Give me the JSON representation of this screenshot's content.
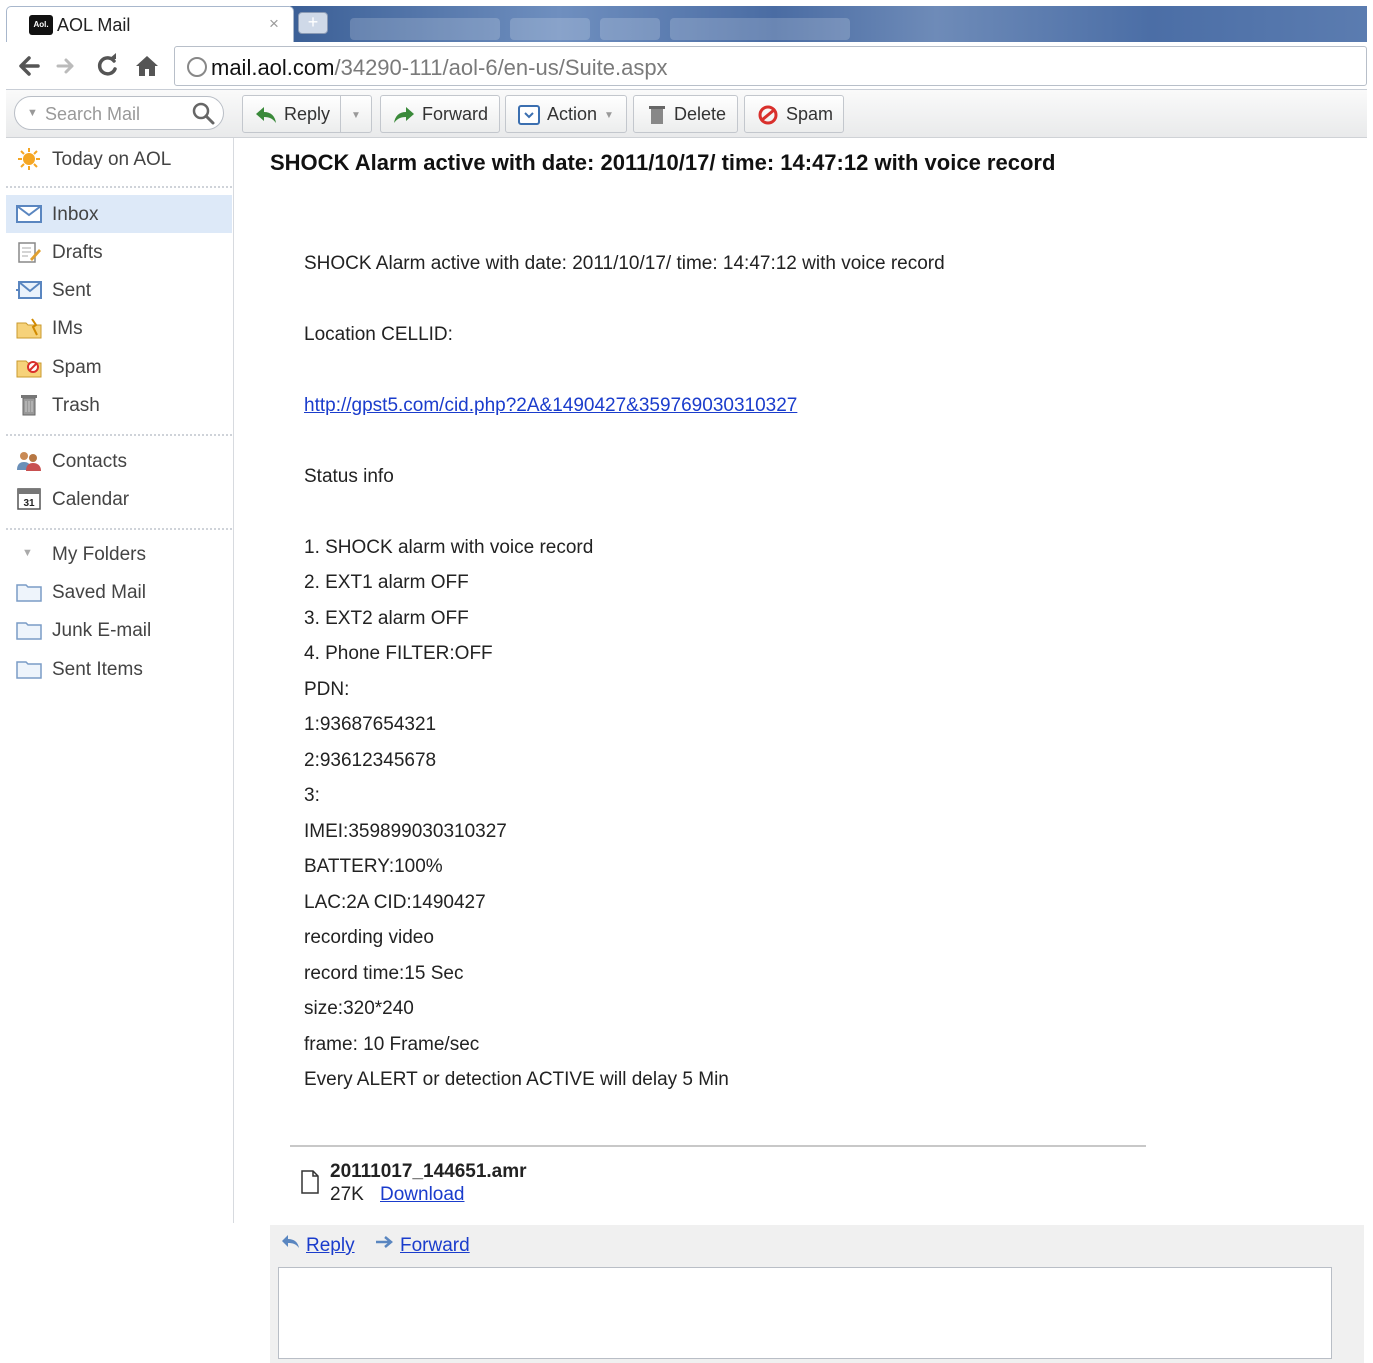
{
  "browser": {
    "tab_title": "AOL Mail",
    "tab_logo_text": "Aol.",
    "tab_close": "×",
    "new_tab": "+",
    "url_host": "mail.aol.com",
    "url_path": "/34290-111/aol-6/en-us/Suite.aspx"
  },
  "toolbar": {
    "search_placeholder": "Search Mail",
    "reply": "Reply",
    "forward": "Forward",
    "action": "Action",
    "delete": "Delete",
    "spam": "Spam"
  },
  "sidebar": {
    "today": "Today on AOL",
    "folders": [
      {
        "label": "Inbox",
        "icon": "inbox-icon"
      },
      {
        "label": "Drafts",
        "icon": "drafts-icon"
      },
      {
        "label": "Sent",
        "icon": "sent-icon"
      },
      {
        "label": "IMs",
        "icon": "ims-icon"
      },
      {
        "label": "Spam",
        "icon": "spam-folder-icon"
      },
      {
        "label": "Trash",
        "icon": "trash-icon"
      }
    ],
    "contacts": "Contacts",
    "calendar": "Calendar",
    "calendar_day": "31",
    "my_folders": "My Folders",
    "custom_folders": [
      "Saved Mail",
      "Junk E-mail",
      "Sent Items"
    ]
  },
  "message": {
    "subject": "SHOCK Alarm active with date: 2011/10/17/ time: 14:47:12 with voice record",
    "line_intro": "SHOCK Alarm active with date: 2011/10/17/ time: 14:47:12  with voice record",
    "line_location": "Location CELLID:",
    "link": "http://gpst5.com/cid.php?2A&1490427&359769030310327",
    "line_status": "Status info",
    "status_lines": [
      "1. SHOCK alarm  with voice record",
      "2. EXT1 alarm OFF",
      "3. EXT2 alarm OFF",
      "4. Phone FILTER:OFF",
      "PDN:",
      "1:93687654321",
      "2:93612345678",
      "3:",
      "IMEI:359899030310327",
      "BATTERY:100%",
      "LAC:2A CID:1490427",
      "recording video",
      "record time:15 Sec",
      "size:320*240",
      "frame: 10 Frame/sec",
      "Every ALERT or detection ACTIVE will delay  5 Min"
    ],
    "attachment": {
      "name": "20111017_144651.amr",
      "size": "27K",
      "download": "Download"
    }
  },
  "quick_reply": {
    "reply": "Reply",
    "forward": "Forward",
    "placeholder": ""
  },
  "colors": {
    "link": "#1a3ccc",
    "selected_folder_bg": "#dde9f8",
    "spam_red": "#d9302c"
  }
}
